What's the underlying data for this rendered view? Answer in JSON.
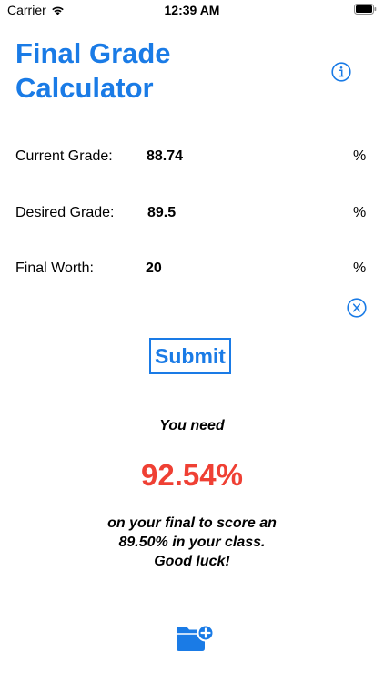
{
  "status_bar": {
    "carrier": "Carrier",
    "time": "12:39 AM"
  },
  "header": {
    "title_line1": "Final Grade",
    "title_line2": "Calculator",
    "info_icon": "info-circle-icon"
  },
  "form": {
    "current_grade": {
      "label": "Current Grade:",
      "value": "88.74",
      "unit": "%"
    },
    "desired_grade": {
      "label": "Desired Grade:",
      "value": "89.5",
      "unit": "%"
    },
    "final_worth": {
      "label": "Final Worth:",
      "value": "20",
      "unit": "%"
    },
    "clear_icon": "clear-x-circle-icon",
    "submit_label": "Submit"
  },
  "result": {
    "intro": "You need",
    "value": "92.54%",
    "line1": "on your final to score an",
    "line2": "89.50% in your class.",
    "line3": "Good luck!"
  },
  "footer": {
    "save_icon": "folder-add-icon"
  },
  "colors": {
    "accent": "#1a7be6",
    "result": "#ef4034"
  }
}
